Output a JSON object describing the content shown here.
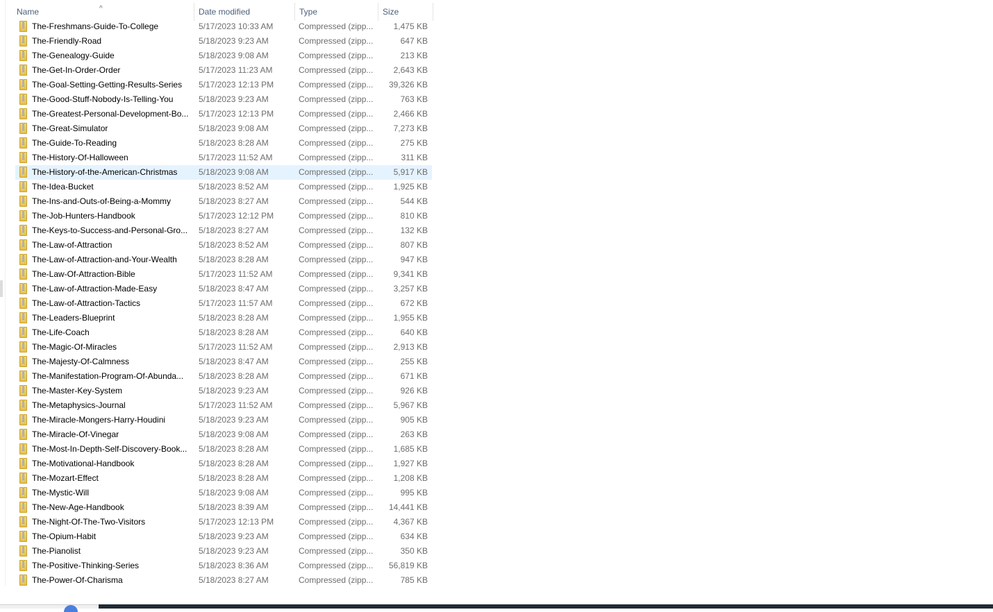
{
  "columns": {
    "name": "Name",
    "date": "Date modified",
    "type": "Type",
    "size": "Size",
    "sort_indicator": "^"
  },
  "selected_index": 10,
  "files": [
    {
      "name": "The-Freshmans-Guide-To-College",
      "date": "5/17/2023 10:33 AM",
      "type": "Compressed (zipp...",
      "size": "1,475 KB"
    },
    {
      "name": "The-Friendly-Road",
      "date": "5/18/2023 9:23 AM",
      "type": "Compressed (zipp...",
      "size": "647 KB"
    },
    {
      "name": "The-Genealogy-Guide",
      "date": "5/18/2023 9:08 AM",
      "type": "Compressed (zipp...",
      "size": "213 KB"
    },
    {
      "name": "The-Get-In-Order-Order",
      "date": "5/17/2023 11:23 AM",
      "type": "Compressed (zipp...",
      "size": "2,643 KB"
    },
    {
      "name": "The-Goal-Setting-Getting-Results-Series",
      "date": "5/17/2023 12:13 PM",
      "type": "Compressed (zipp...",
      "size": "39,326 KB"
    },
    {
      "name": "The-Good-Stuff-Nobody-Is-Telling-You",
      "date": "5/18/2023 9:23 AM",
      "type": "Compressed (zipp...",
      "size": "763 KB"
    },
    {
      "name": "The-Greatest-Personal-Development-Bo...",
      "date": "5/17/2023 12:13 PM",
      "type": "Compressed (zipp...",
      "size": "2,466 KB"
    },
    {
      "name": "The-Great-Simulator",
      "date": "5/18/2023 9:08 AM",
      "type": "Compressed (zipp...",
      "size": "7,273 KB"
    },
    {
      "name": "The-Guide-To-Reading",
      "date": "5/18/2023 8:28 AM",
      "type": "Compressed (zipp...",
      "size": "275 KB"
    },
    {
      "name": "The-History-Of-Halloween",
      "date": "5/17/2023 11:52 AM",
      "type": "Compressed (zipp...",
      "size": "311 KB"
    },
    {
      "name": "The-History-of-the-American-Christmas",
      "date": "5/18/2023 9:08 AM",
      "type": "Compressed (zipp...",
      "size": "5,917 KB"
    },
    {
      "name": "The-Idea-Bucket",
      "date": "5/18/2023 8:52 AM",
      "type": "Compressed (zipp...",
      "size": "1,925 KB"
    },
    {
      "name": "The-Ins-and-Outs-of-Being-a-Mommy",
      "date": "5/18/2023 8:27 AM",
      "type": "Compressed (zipp...",
      "size": "544 KB"
    },
    {
      "name": "The-Job-Hunters-Handbook",
      "date": "5/17/2023 12:12 PM",
      "type": "Compressed (zipp...",
      "size": "810 KB"
    },
    {
      "name": "The-Keys-to-Success-and-Personal-Gro...",
      "date": "5/18/2023 8:27 AM",
      "type": "Compressed (zipp...",
      "size": "132 KB"
    },
    {
      "name": "The-Law-of-Attraction",
      "date": "5/18/2023 8:52 AM",
      "type": "Compressed (zipp...",
      "size": "807 KB"
    },
    {
      "name": "The-Law-of-Attraction-and-Your-Wealth",
      "date": "5/18/2023 8:28 AM",
      "type": "Compressed (zipp...",
      "size": "947 KB"
    },
    {
      "name": "The-Law-Of-Attraction-Bible",
      "date": "5/17/2023 11:52 AM",
      "type": "Compressed (zipp...",
      "size": "9,341 KB"
    },
    {
      "name": "The-Law-of-Attraction-Made-Easy",
      "date": "5/18/2023 8:47 AM",
      "type": "Compressed (zipp...",
      "size": "3,257 KB"
    },
    {
      "name": "The-Law-of-Attraction-Tactics",
      "date": "5/17/2023 11:57 AM",
      "type": "Compressed (zipp...",
      "size": "672 KB"
    },
    {
      "name": "The-Leaders-Blueprint",
      "date": "5/18/2023 8:28 AM",
      "type": "Compressed (zipp...",
      "size": "1,955 KB"
    },
    {
      "name": "The-Life-Coach",
      "date": "5/18/2023 8:28 AM",
      "type": "Compressed (zipp...",
      "size": "640 KB"
    },
    {
      "name": "The-Magic-Of-Miracles",
      "date": "5/17/2023 11:52 AM",
      "type": "Compressed (zipp...",
      "size": "2,913 KB"
    },
    {
      "name": "The-Majesty-Of-Calmness",
      "date": "5/18/2023 8:47 AM",
      "type": "Compressed (zipp...",
      "size": "255 KB"
    },
    {
      "name": "The-Manifestation-Program-Of-Abunda...",
      "date": "5/18/2023 8:28 AM",
      "type": "Compressed (zipp...",
      "size": "671 KB"
    },
    {
      "name": "The-Master-Key-System",
      "date": "5/18/2023 9:23 AM",
      "type": "Compressed (zipp...",
      "size": "926 KB"
    },
    {
      "name": "The-Metaphysics-Journal",
      "date": "5/17/2023 11:52 AM",
      "type": "Compressed (zipp...",
      "size": "5,967 KB"
    },
    {
      "name": "The-Miracle-Mongers-Harry-Houdini",
      "date": "5/18/2023 9:23 AM",
      "type": "Compressed (zipp...",
      "size": "905 KB"
    },
    {
      "name": "The-Miracle-Of-Vinegar",
      "date": "5/18/2023 9:08 AM",
      "type": "Compressed (zipp...",
      "size": "263 KB"
    },
    {
      "name": "The-Most-In-Depth-Self-Discovery-Book...",
      "date": "5/18/2023 8:28 AM",
      "type": "Compressed (zipp...",
      "size": "1,685 KB"
    },
    {
      "name": "The-Motivational-Handbook",
      "date": "5/18/2023 8:28 AM",
      "type": "Compressed (zipp...",
      "size": "1,927 KB"
    },
    {
      "name": "The-Mozart-Effect",
      "date": "5/18/2023 8:28 AM",
      "type": "Compressed (zipp...",
      "size": "1,208 KB"
    },
    {
      "name": "The-Mystic-Will",
      "date": "5/18/2023 9:08 AM",
      "type": "Compressed (zipp...",
      "size": "995 KB"
    },
    {
      "name": "The-New-Age-Handbook",
      "date": "5/18/2023 8:39 AM",
      "type": "Compressed (zipp...",
      "size": "14,441 KB"
    },
    {
      "name": "The-Night-Of-The-Two-Visitors",
      "date": "5/17/2023 12:13 PM",
      "type": "Compressed (zipp...",
      "size": "4,367 KB"
    },
    {
      "name": "The-Opium-Habit",
      "date": "5/18/2023 9:23 AM",
      "type": "Compressed (zipp...",
      "size": "634 KB"
    },
    {
      "name": "The-Pianolist",
      "date": "5/18/2023 9:23 AM",
      "type": "Compressed (zipp...",
      "size": "350 KB"
    },
    {
      "name": "The-Positive-Thinking-Series",
      "date": "5/18/2023 8:36 AM",
      "type": "Compressed (zipp...",
      "size": "56,819 KB"
    },
    {
      "name": "The-Power-Of-Charisma",
      "date": "5/18/2023 8:27 AM",
      "type": "Compressed (zipp...",
      "size": "785 KB"
    }
  ]
}
